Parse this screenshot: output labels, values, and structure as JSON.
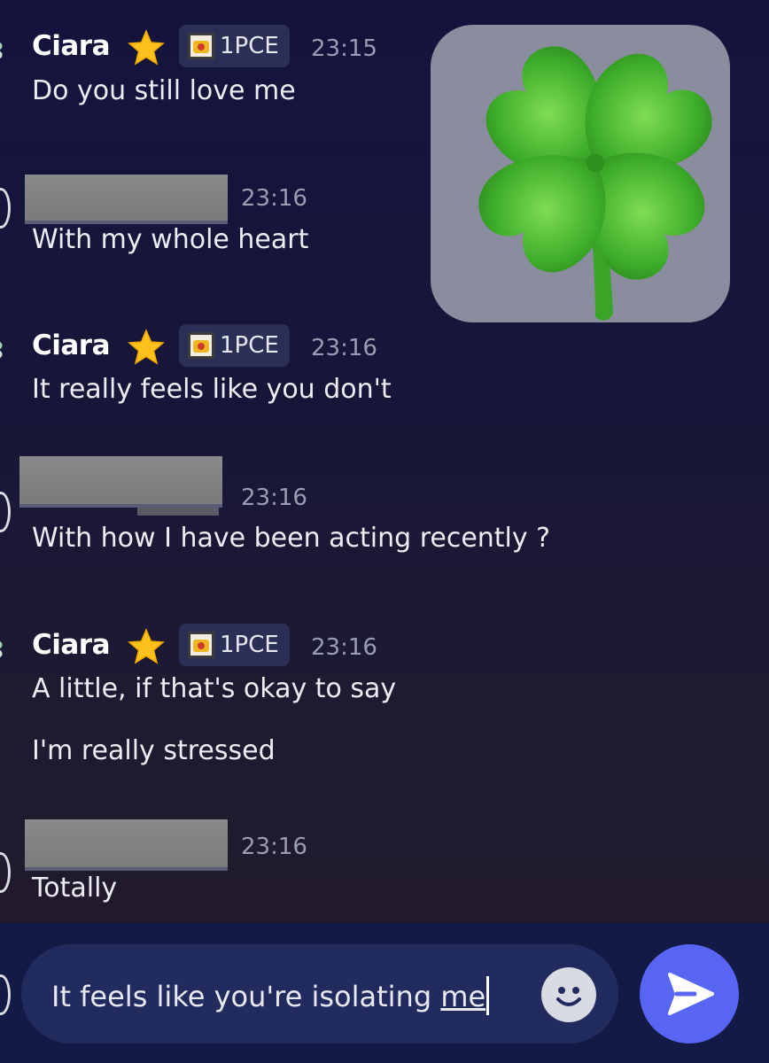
{
  "messages": [
    {
      "author": "Ciara",
      "badge": "1PCE",
      "time": "23:15",
      "lines": [
        "Do you still love me"
      ]
    },
    {
      "author": "",
      "time": "23:16",
      "lines": [
        "With my whole heart"
      ]
    },
    {
      "author": "Ciara",
      "badge": "1PCE",
      "time": "23:16",
      "lines": [
        "It really feels like you don't"
      ]
    },
    {
      "author": "",
      "time": "23:16",
      "lines": [
        "With how I have been acting recently ?"
      ]
    },
    {
      "author": "Ciara",
      "badge": "1PCE",
      "time": "23:16",
      "lines": [
        "A little, if that's okay to say",
        "I'm really stressed"
      ]
    },
    {
      "author": "",
      "time": "23:16",
      "lines": [
        "Totally"
      ]
    }
  ],
  "sticker": {
    "icon": "four-leaf-clover-icon"
  },
  "composer": {
    "draft_prefix": "It feels like you're isolating ",
    "draft_underlined": "me",
    "emoji_icon": "smiley-icon",
    "send_icon": "send-arrow-icon"
  },
  "colors": {
    "accent": "#5865f2",
    "badge_bg": "#2b2e55",
    "timestamp": "#9a9cb2"
  }
}
